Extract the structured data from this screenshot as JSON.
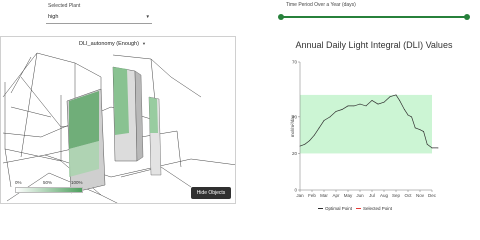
{
  "controls": {
    "plant_label": "Selected Plant",
    "plant_value": "high",
    "period_label": "Time Period Over a Year (days)",
    "period_range": [
      0,
      1
    ]
  },
  "viewer": {
    "metric_value": "DLI_autonomy (Enough)",
    "legend_ticks": [
      "0%",
      "50%",
      "100%"
    ],
    "hide_button": "Hide Objects"
  },
  "colors": {
    "accent": "#27813b",
    "legend_high": "#4e9f5e",
    "optimal_band": "#ccf5d4",
    "series_line": "#303030"
  },
  "chart_data": {
    "type": "line",
    "title": "Annual Daily Light Integral (DLI) Values",
    "ylabel": "mol/m²/day",
    "ylim": [
      0,
      70
    ],
    "yticks": [
      0,
      20,
      40,
      70
    ],
    "categories": [
      "Jan",
      "Feb",
      "Mar",
      "Apr",
      "May",
      "Jun",
      "Jul",
      "Aug",
      "Sep",
      "Oct",
      "Nov",
      "Dec"
    ],
    "optimal_band": [
      20,
      52
    ],
    "series": [
      {
        "x": [
          0.0,
          0.4,
          0.8,
          1.2,
          1.6,
          2.0,
          2.5,
          3.0,
          3.5,
          4.0,
          4.5,
          5.0,
          5.5,
          6.0,
          6.5,
          7.0,
          7.5,
          8.0,
          8.3,
          8.7,
          9.0,
          9.3,
          9.6,
          10.0,
          10.3,
          10.6,
          11.0,
          11.5
        ],
        "values": [
          24,
          25,
          27,
          30,
          34,
          38,
          40,
          43,
          44,
          46,
          46,
          47,
          46,
          49,
          47,
          48,
          51,
          52,
          49,
          44,
          41,
          40,
          34,
          33,
          32,
          25,
          23,
          23
        ]
      }
    ],
    "legend": [
      "Optimal Point",
      "Selected Point"
    ]
  }
}
